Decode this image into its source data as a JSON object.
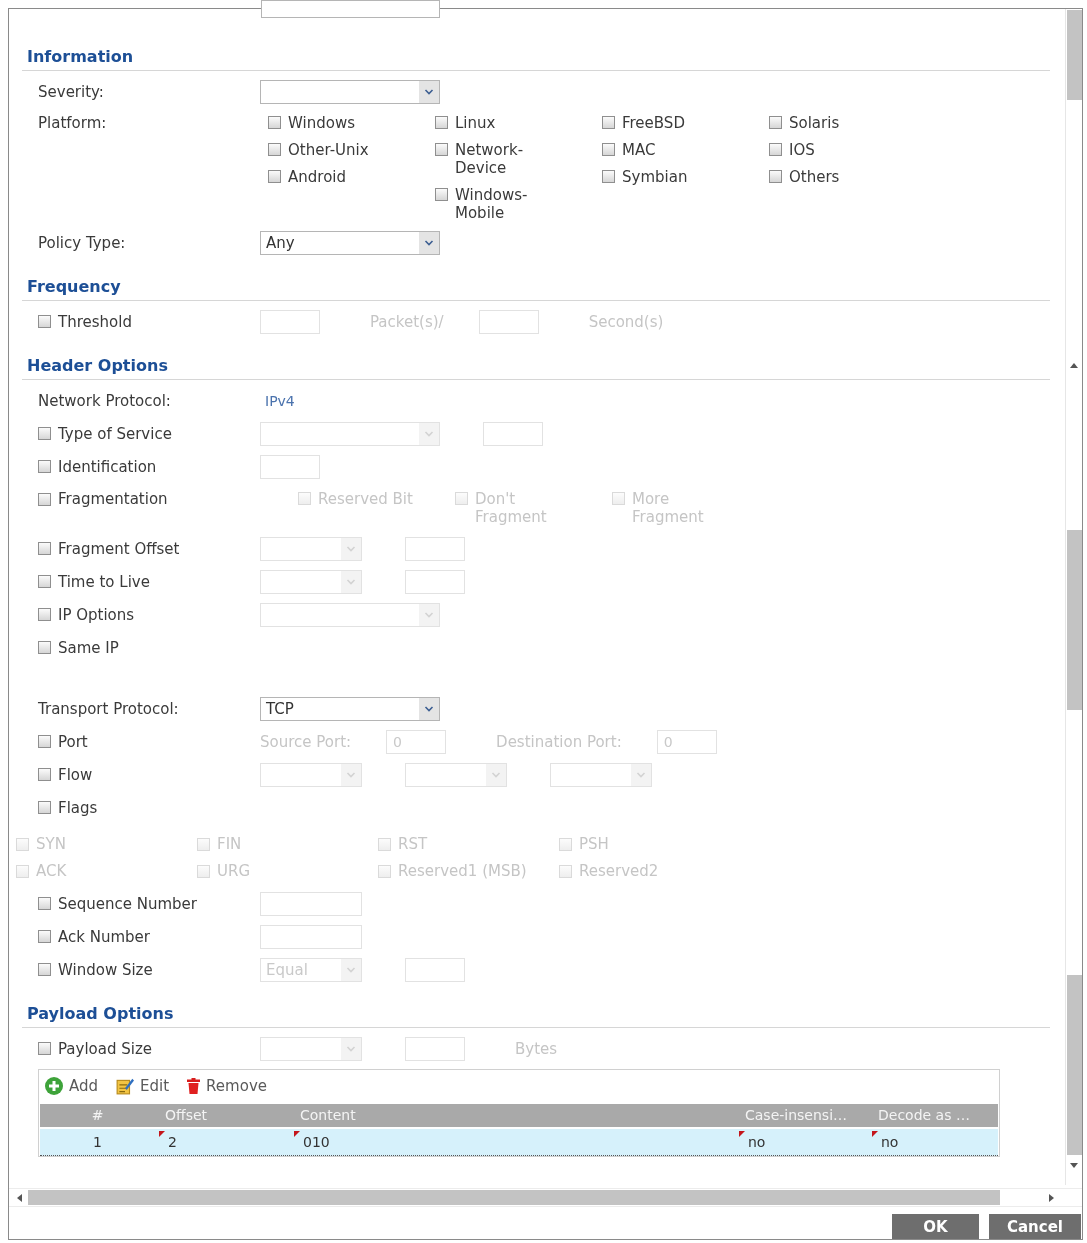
{
  "signature_field": {
    "disabled": false
  },
  "sections": [
    {
      "title": "Information",
      "groups": [
        [
          {
            "kind": "field",
            "label": "Severity:",
            "controls": [
              {
                "kind": "select",
                "disabled": false
              }
            ]
          },
          {
            "kind": "options",
            "label": "Platform:",
            "columns": [
              [
                {
                  "label": "Windows",
                  "checked": false
                },
                {
                  "label": "Other-Unix",
                  "checked": false
                },
                {
                  "label": "Android",
                  "checked": false
                }
              ],
              [
                {
                  "label": "Linux",
                  "checked": false
                },
                {
                  "label": "Network-Device",
                  "checked": false
                },
                {
                  "label": "Windows-Mobile",
                  "checked": false
                }
              ],
              [
                {
                  "label": "FreeBSD",
                  "checked": false
                },
                {
                  "label": "MAC",
                  "checked": false
                },
                {
                  "label": "Symbian",
                  "checked": false
                }
              ],
              [
                {
                  "label": "Solaris",
                  "checked": false
                },
                {
                  "label": "IOS",
                  "checked": false
                },
                {
                  "label": "Others",
                  "checked": false
                }
              ]
            ]
          },
          {
            "kind": "field",
            "label": "Policy Type:",
            "controls": [
              {
                "kind": "select",
                "value": "Any",
                "disabled": false
              }
            ]
          }
        ]
      ]
    },
    {
      "title": "Frequency",
      "groups": [
        [
          {
            "kind": "check",
            "label": "Threshold",
            "checked": false,
            "controls": [
              {
                "kind": "input",
                "disabled": true
              },
              {
                "kind": "caption",
                "text": "Packet(s)/",
                "disabled": true
              },
              {
                "kind": "input",
                "disabled": true
              },
              {
                "kind": "caption",
                "text": "Second(s)",
                "disabled": true
              }
            ]
          }
        ]
      ]
    },
    {
      "title": "Header Options",
      "groups": [
        [
          {
            "kind": "field",
            "label": "Network Protocol:",
            "controls": [
              {
                "kind": "value",
                "text": "IPv4"
              }
            ]
          },
          {
            "kind": "check",
            "label": "Type of Service",
            "checked": false,
            "controls": [
              {
                "kind": "select",
                "disabled": true
              },
              {
                "kind": "input",
                "disabled": true
              }
            ]
          },
          {
            "kind": "check",
            "label": "Identification",
            "checked": false,
            "controls": [
              {
                "kind": "input",
                "disabled": true
              }
            ]
          },
          {
            "kind": "check",
            "label": "Fragmentation",
            "checked": false,
            "controls": [
              {
                "kind": "checkbox",
                "label": "Reserved Bit",
                "checked": false,
                "disabled": true
              },
              {
                "kind": "checkbox",
                "label": "Don't Fragment",
                "checked": false,
                "disabled": true
              },
              {
                "kind": "checkbox",
                "label": "More Fragment",
                "checked": false,
                "disabled": true
              }
            ]
          },
          {
            "kind": "check",
            "label": "Fragment Offset",
            "checked": false,
            "controls": [
              {
                "kind": "short-select",
                "disabled": true
              },
              {
                "kind": "input",
                "disabled": true
              }
            ]
          },
          {
            "kind": "check",
            "label": "Time to Live",
            "checked": false,
            "controls": [
              {
                "kind": "short-select",
                "disabled": true
              },
              {
                "kind": "input",
                "disabled": true
              }
            ]
          },
          {
            "kind": "check",
            "label": "IP Options",
            "checked": false,
            "controls": [
              {
                "kind": "select",
                "disabled": true
              }
            ]
          },
          {
            "kind": "check",
            "label": "Same IP",
            "checked": false
          }
        ],
        [
          {
            "kind": "field",
            "label": "Transport Protocol:",
            "controls": [
              {
                "kind": "select",
                "value": "TCP",
                "disabled": false
              }
            ]
          },
          {
            "kind": "check",
            "label": "Port",
            "checked": false,
            "controls": [
              {
                "kind": "caption",
                "text": "Source Port:",
                "disabled": true
              },
              {
                "kind": "input",
                "value": "0",
                "disabled": true
              },
              {
                "kind": "caption",
                "text": "Destination Port:",
                "disabled": true
              },
              {
                "kind": "input",
                "value": "0",
                "disabled": true
              }
            ]
          },
          {
            "kind": "check",
            "label": "Flow",
            "checked": false,
            "controls": [
              {
                "kind": "short-select",
                "disabled": true
              },
              {
                "kind": "short-select",
                "disabled": true
              },
              {
                "kind": "short-select",
                "disabled": true
              }
            ]
          },
          {
            "kind": "check",
            "label": "Flags",
            "checked": false
          },
          {
            "kind": "flags",
            "items": [
              {
                "label": "SYN",
                "checked": false,
                "disabled": true
              },
              {
                "label": "FIN",
                "checked": false,
                "disabled": true
              },
              {
                "label": "RST",
                "checked": false,
                "disabled": true
              },
              {
                "label": "PSH",
                "checked": false,
                "disabled": true
              },
              {
                "label": "ACK",
                "checked": false,
                "disabled": true
              },
              {
                "label": "URG",
                "checked": false,
                "disabled": true
              },
              {
                "label": "Reserved1 (MSB)",
                "checked": false,
                "disabled": true
              },
              {
                "label": "Reserved2",
                "checked": false,
                "disabled": true
              }
            ]
          },
          {
            "kind": "check",
            "label": "Sequence Number",
            "checked": false,
            "controls": [
              {
                "kind": "wide-input",
                "disabled": true
              }
            ]
          },
          {
            "kind": "check",
            "label": "Ack Number",
            "checked": false,
            "controls": [
              {
                "kind": "wide-input",
                "disabled": true
              }
            ]
          },
          {
            "kind": "check",
            "label": "Window Size",
            "checked": false,
            "controls": [
              {
                "kind": "short-select",
                "value": "Equal",
                "disabled": true
              },
              {
                "kind": "input",
                "disabled": true
              }
            ]
          }
        ]
      ]
    },
    {
      "title": "Payload Options",
      "groups": [
        [
          {
            "kind": "check",
            "label": "Payload Size",
            "checked": false,
            "controls": [
              {
                "kind": "short-select",
                "disabled": true
              },
              {
                "kind": "input",
                "disabled": true
              },
              {
                "kind": "caption",
                "text": "Bytes",
                "disabled": true
              }
            ]
          }
        ]
      ],
      "table": {
        "toolbar": [
          {
            "kind": "add",
            "label": "Add"
          },
          {
            "kind": "edit",
            "label": "Edit"
          },
          {
            "kind": "remove",
            "label": "Remove"
          }
        ],
        "columns": [
          "#",
          "Offset",
          "Content",
          "Case-insensi…",
          "Decode as …"
        ],
        "rows": [
          {
            "selected": true,
            "cells": [
              {
                "text": "1",
                "modified": false
              },
              {
                "text": "2",
                "modified": true
              },
              {
                "text": "010",
                "modified": true
              },
              {
                "text": "no",
                "modified": true
              },
              {
                "text": "no",
                "modified": true
              }
            ]
          }
        ]
      }
    }
  ],
  "dialog_buttons": [
    {
      "label": "OK"
    },
    {
      "label": "Cancel"
    }
  ]
}
